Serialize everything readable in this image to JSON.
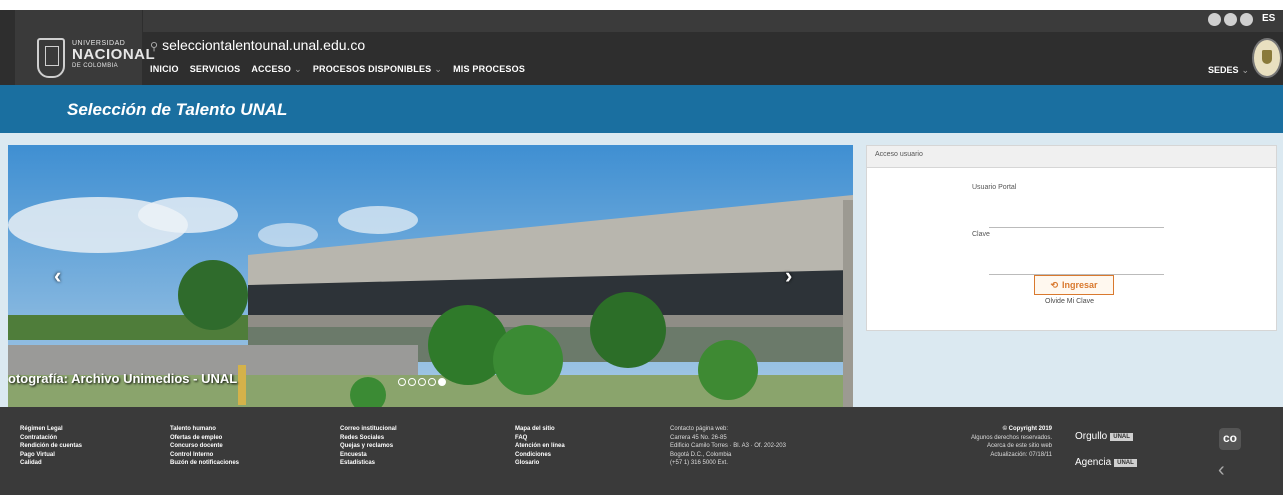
{
  "header": {
    "logo": {
      "line1": "UNIVERSIDAD",
      "line2": "NACIONAL",
      "line3": "DE COLOMBIA"
    },
    "site_url": "selecciontalentounal.unal.edu.co",
    "nav": [
      {
        "label": "INICIO"
      },
      {
        "label": "SERVICIOS"
      },
      {
        "label": "ACCESO"
      },
      {
        "label": "PROCESOS DISPONIBLES"
      },
      {
        "label": "MIS PROCESOS"
      }
    ],
    "language": "ES",
    "sedes": "SEDES"
  },
  "title_bar": {
    "title": "Selección de Talento UNAL"
  },
  "carousel": {
    "caption": "otografía: Archivo Unimedios - UNAL",
    "prev_icon": "chevron-left-icon",
    "next_icon": "chevron-right-icon",
    "prev_glyph": "‹",
    "next_glyph": "›",
    "slide_count": 5,
    "active_slide": 4
  },
  "login": {
    "heading": "Acceso usuario",
    "username_label": "Usuario Portal",
    "username_value": "",
    "password_label": "Clave",
    "password_value": "",
    "submit_label": "Ingresar",
    "forgot_label": "Olvide Mi Clave"
  },
  "footer": {
    "col1": [
      "Régimen Legal",
      "Contratación",
      "Rendición de cuentas",
      "Pago Virtual",
      "Calidad"
    ],
    "col2": [
      "Talento humano",
      "Ofertas de empleo",
      "Concurso docente",
      "Control Interno",
      "Buzón de notificaciones"
    ],
    "col3": [
      "Correo institucional",
      "Redes Sociales",
      "Quejas y reclamos",
      "Encuesta",
      "Estadísticas"
    ],
    "col4": [
      "Mapa del sitio",
      "FAQ",
      "Atención en línea",
      "Condiciones",
      "Glosario"
    ],
    "contact": [
      "Contacto página web:",
      "Carrera 45 No. 26-85",
      "Edificio Camilo Torres · Bl. A3 · Of. 202-203",
      "Bogotá D.C., Colombia",
      "(+57 1) 316 5000 Ext."
    ],
    "copyright": [
      "© Copyright 2019",
      "Algunos derechos reservados.",
      "Acerca de este sitio web",
      "Actualización: 07/18/11"
    ],
    "brand1": "Orgullo",
    "brand2": "Agencia",
    "brand_tag": "UNAL",
    "co_label": "co"
  }
}
